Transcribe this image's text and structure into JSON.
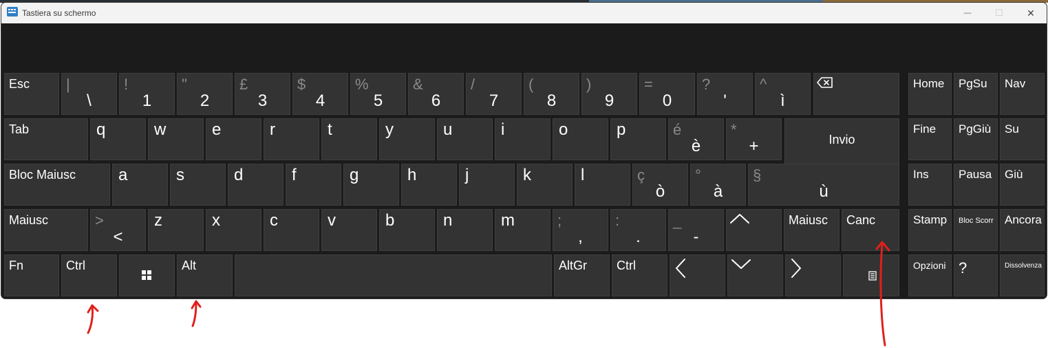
{
  "window": {
    "title": "Tastiera su schermo",
    "min_glyph": "—",
    "max_glyph": "☐",
    "close_glyph": "✕"
  },
  "rows": {
    "numbers": [
      {
        "id": "esc",
        "label": "Esc"
      },
      {
        "id": "backslash",
        "sec": "|",
        "pri": "\\"
      },
      {
        "id": "1",
        "sec": "!",
        "pri": "1"
      },
      {
        "id": "2",
        "sec": "\"",
        "pri": "2"
      },
      {
        "id": "3",
        "sec": "£",
        "pri": "3"
      },
      {
        "id": "4",
        "sec": "$",
        "pri": "4"
      },
      {
        "id": "5",
        "sec": "%",
        "pri": "5"
      },
      {
        "id": "6",
        "sec": "&",
        "pri": "6"
      },
      {
        "id": "7",
        "sec": "/",
        "pri": "7"
      },
      {
        "id": "8",
        "sec": "(",
        "pri": "8"
      },
      {
        "id": "9",
        "sec": ")",
        "pri": "9"
      },
      {
        "id": "0",
        "sec": "=",
        "pri": "0"
      },
      {
        "id": "apostrophe",
        "sec": "?",
        "pri": "'"
      },
      {
        "id": "igrave",
        "sec": "^",
        "pri": "ì"
      }
    ],
    "top": [
      {
        "id": "tab",
        "label": "Tab"
      },
      {
        "id": "q",
        "label": "q"
      },
      {
        "id": "w",
        "label": "w"
      },
      {
        "id": "e",
        "label": "e"
      },
      {
        "id": "r",
        "label": "r"
      },
      {
        "id": "t",
        "label": "t"
      },
      {
        "id": "y",
        "label": "y"
      },
      {
        "id": "u",
        "label": "u"
      },
      {
        "id": "i",
        "label": "i"
      },
      {
        "id": "o",
        "label": "o"
      },
      {
        "id": "p",
        "label": "p"
      },
      {
        "id": "egrave",
        "sec": "é",
        "pri": "è"
      },
      {
        "id": "plus",
        "sec": "*",
        "pri": "+"
      },
      {
        "id": "invio",
        "label": "Invio"
      }
    ],
    "home": [
      {
        "id": "capslock",
        "label": "Bloc Maiusc"
      },
      {
        "id": "a",
        "label": "a"
      },
      {
        "id": "s",
        "label": "s"
      },
      {
        "id": "d",
        "label": "d"
      },
      {
        "id": "f",
        "label": "f"
      },
      {
        "id": "g",
        "label": "g"
      },
      {
        "id": "h",
        "label": "h"
      },
      {
        "id": "j",
        "label": "j"
      },
      {
        "id": "k",
        "label": "k"
      },
      {
        "id": "l",
        "label": "l"
      },
      {
        "id": "ograve",
        "sec": "ç",
        "pri": "ò"
      },
      {
        "id": "agrave",
        "sec": "°",
        "pri": "à"
      },
      {
        "id": "ugrave",
        "sec": "§",
        "pri": "ù"
      }
    ],
    "bottom": [
      {
        "id": "lshift",
        "label": "Maiusc"
      },
      {
        "id": "less",
        "sec": ">",
        "pri": "<"
      },
      {
        "id": "z",
        "label": "z"
      },
      {
        "id": "x",
        "label": "x"
      },
      {
        "id": "c",
        "label": "c"
      },
      {
        "id": "v",
        "label": "v"
      },
      {
        "id": "b",
        "label": "b"
      },
      {
        "id": "n",
        "label": "n"
      },
      {
        "id": "m",
        "label": "m"
      },
      {
        "id": "comma",
        "sec": ";",
        "pri": ","
      },
      {
        "id": "period",
        "sec": ":",
        "pri": "."
      },
      {
        "id": "minus",
        "sec": "_",
        "pri": "-"
      },
      {
        "id": "up",
        "icon": "up-arrow-icon"
      },
      {
        "id": "rshift",
        "label": "Maiusc"
      },
      {
        "id": "canc",
        "label": "Canc"
      }
    ],
    "space": [
      {
        "id": "fn",
        "label": "Fn"
      },
      {
        "id": "lctrl",
        "label": "Ctrl"
      },
      {
        "id": "win",
        "icon": "windows-logo-icon"
      },
      {
        "id": "alt",
        "label": "Alt"
      },
      {
        "id": "space",
        "label": ""
      },
      {
        "id": "altgr",
        "label": "AltGr"
      },
      {
        "id": "rctrl",
        "label": "Ctrl"
      },
      {
        "id": "left",
        "icon": "left-arrow-icon"
      },
      {
        "id": "down",
        "icon": "down-arrow-icon"
      },
      {
        "id": "right",
        "icon": "right-arrow-icon"
      },
      {
        "id": "menu",
        "icon": "context-menu-icon"
      }
    ]
  },
  "nav_keys": [
    {
      "id": "home",
      "label": "Home"
    },
    {
      "id": "pgsu",
      "label": "PgSu"
    },
    {
      "id": "nav",
      "label": "Nav"
    },
    {
      "id": "fine",
      "label": "Fine"
    },
    {
      "id": "pggiu",
      "label": "PgGiù"
    },
    {
      "id": "su",
      "label": "Su"
    },
    {
      "id": "ins",
      "label": "Ins"
    },
    {
      "id": "pausa",
      "label": "Pausa"
    },
    {
      "id": "giu",
      "label": "Giù"
    },
    {
      "id": "stamp",
      "label": "Stamp"
    },
    {
      "id": "blocscorr",
      "label": "Bloc Scorr"
    },
    {
      "id": "ancora",
      "label": "Ancora"
    },
    {
      "id": "opzioni",
      "label": "Opzioni"
    },
    {
      "id": "help",
      "label": "?"
    },
    {
      "id": "dissolvenza",
      "label": "Dissolvenza"
    }
  ],
  "colors": {
    "key": "#333333",
    "window_bg": "#1b1b1b",
    "secondary_text": "#8a8a8a",
    "annotation": "#e0201c"
  }
}
